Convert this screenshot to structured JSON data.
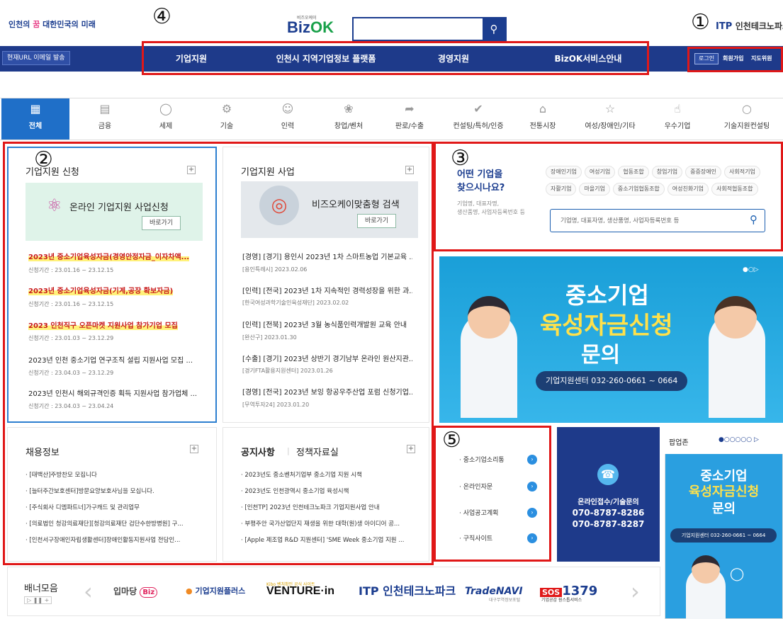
{
  "header": {
    "logo_left_1": "인천의 ",
    "logo_left_2": "꿈",
    "logo_left_3": " 대한민국의 ",
    "logo_left_4": "미래",
    "bizok_small": "비즈오케이",
    "bizok_biz": "Biz",
    "bizok_ok": "OK",
    "itp": "ITP",
    "itp_name": "인천테크노파크",
    "markers": {
      "m1": "①",
      "m2": "②",
      "m3": "③",
      "m4": "④",
      "m5": "⑤"
    }
  },
  "nav": {
    "url_email": "현재URL 이메일 발송",
    "items": [
      "기업지원",
      "인천시 지역기업정보 플랫폼",
      "경영지원",
      "BizOK서비스안내"
    ],
    "login": "로그인",
    "signup": "회원가입",
    "sitemap": "지도위원"
  },
  "categories": [
    {
      "label": "전체",
      "icon": "grid-icon"
    },
    {
      "label": "금융",
      "icon": "chart-icon"
    },
    {
      "label": "세제",
      "icon": "coin-icon"
    },
    {
      "label": "기술",
      "icon": "gear-icon"
    },
    {
      "label": "인력",
      "icon": "person-icon"
    },
    {
      "label": "창업/벤처",
      "icon": "sprout-icon"
    },
    {
      "label": "판로/수출",
      "icon": "arrow-icon"
    },
    {
      "label": "컨설팅/특허/인증",
      "icon": "check-icon"
    },
    {
      "label": "전통시장",
      "icon": "market-icon"
    },
    {
      "label": "여성/장애인/기타",
      "icon": "star-icon"
    },
    {
      "label": "우수기업",
      "icon": "thumb-icon"
    },
    {
      "label": "기술지원컨설팅",
      "icon": "chat-icon"
    }
  ],
  "panel_apply": {
    "title": "기업지원 신청",
    "promo": "온라인 기업지원 사업신청",
    "promo_btn": "바로가기",
    "items": [
      {
        "t": "2023년 중소기업육성자금(경영안정자금_이자차액...",
        "s": "신청기간 : 23.01.16 ~ 23.12.15"
      },
      {
        "t": "2023년 중소기업육성자금(기계,공장 확보자금)",
        "s": "신청기간 : 23.01.16 ~ 23.12.15"
      },
      {
        "t": "2023 인천직구 오픈마켓 지원사업 참가기업 모집",
        "s": "신청기간 : 23.01.03 ~ 23.12.29"
      },
      {
        "t": "2023년 인천 중소기업 연구조직 설립 지원사업 모집 ...",
        "s": "신청기간 : 23.04.03 ~ 23.12.29"
      },
      {
        "t": "2023년 인천시 해외규격인증 획득 지원사업 참가업체 ...",
        "s": "신청기간 : 23.04.03 ~ 23.04.24"
      }
    ]
  },
  "panel_support": {
    "title": "기업지원 사업",
    "promo": "비즈오케이맞춤형 검색",
    "promo_btn": "바로가기",
    "items": [
      {
        "t": "[경영] [경기] 용인시 2023년 1차 스마트농업 기본교육 ...",
        "s": "[용인특례시] 2023.02.06"
      },
      {
        "t": "[인력] [전국] 2023년 1차 지속적인 경력성장을 위한 과...",
        "s": "[한국여성과학기술인육성재단] 2023.02.02"
      },
      {
        "t": "[인력] [전북] 2023년 3월 농식품인력개발원 교육 안내",
        "s": "[완산구] 2023.01.30"
      },
      {
        "t": "[수출] [경기] 2023년 상반기 경기남부 온라인 원산지관...",
        "s": "[경기FTA활용지원센터] 2023.01.26"
      },
      {
        "t": "[경영] [전국] 2023년 보잉 항공우주산업 포럼 신청기업...",
        "s": "[무역투자24] 2023.01.20"
      }
    ]
  },
  "search_panel": {
    "title1": "어떤 기업을",
    "title2": "찾으시나요?",
    "desc1": "기업명, 대표자명,",
    "desc2": "생산품명, 사업자등록번호 등",
    "tags": [
      "장애인기업",
      "여성기업",
      "협동조합",
      "창업기업",
      "중증장애인",
      "사회적기업",
      "자활기업",
      "마을기업",
      "중소기업협동조합",
      "여성친화기업",
      "사회적협동조합"
    ],
    "placeholder": "기업명, 대표자명, 생산품명, 사업자등록번호 등"
  },
  "main_banner": {
    "line1": "중소기업",
    "line2": "육성자금신청",
    "line3": "문의",
    "contact": "기업지원센터 032-260-0661 ~ 0664"
  },
  "jobs": {
    "title": "채용정보",
    "items": [
      "[태백산]주방찬모 모집니다",
      "[늘터주간보호센터]방문요양보호사님을 모십니다.",
      "[주식회사 디엠파트너]가구캐드 및 관리업무",
      "[의료법인 청강의료재단][청강의료재단 검단수한방병원] 구...",
      "[인천서구장애인자립생활센터]장애인활동지원사업 전담인..."
    ]
  },
  "notice": {
    "title": "공지사항",
    "title2": "정책자료실",
    "items": [
      "2023년도 중소벤처기업부 중소기업 지원 시책",
      "2023년도 인천광역시 중소기업 육성시책",
      "[인천TP] 2023년 인천테크노파크 기업지원사업 안내",
      "부평주안 국가산업단지 재생을 위한 대학(원)생 아이디어 공...",
      "[Apple 제조업 R&D 지원센터] 'SME Week 중소기업 지원 ..."
    ]
  },
  "side_links": [
    "중소기업소리통",
    "온라인자문",
    "사업공고계획",
    "구직사이트"
  ],
  "contact": {
    "title": "온라인접수/기술문의",
    "phone1": "070-8787-8286",
    "phone2": "070-8787-8287"
  },
  "popup": {
    "title": "팝업존",
    "line1": "중소기업",
    "line2": "육성자금신청",
    "line3": "문의",
    "contact": "기업지원센터 032-260-0661 ~ 0664"
  },
  "banners": {
    "title": "배너모음",
    "items": [
      "입마당",
      "기업지원플러스",
      "VENTURE·in",
      "ITP 인천테크노파크",
      "TradeNAVI",
      "1379"
    ],
    "kibo": "Kibo 벤처확인 공식 사이트",
    "sos": "SOS",
    "sos_sub": "기업공감 원스톱서비스",
    "trade_sub": "대구무역정보포털"
  }
}
